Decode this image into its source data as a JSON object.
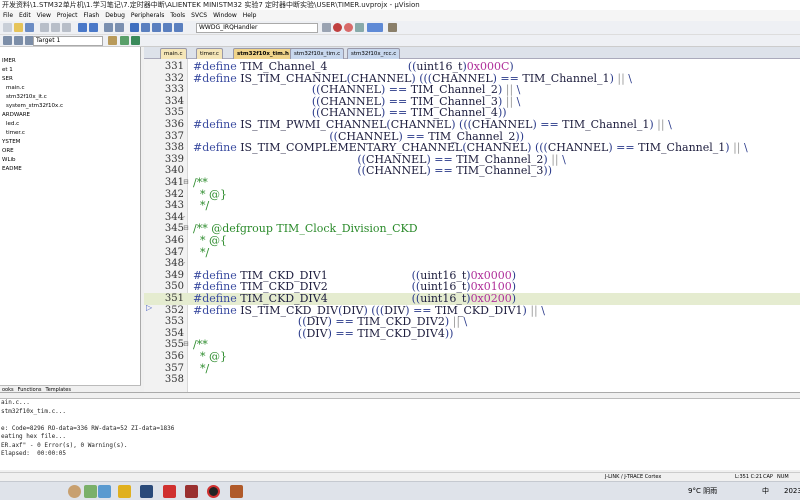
{
  "window": {
    "title": "开发资料\\1.STM32单片机\\1.学习笔记\\7.定时器中断\\ALIENTEK MINISTM32 实验7 定时器中断实验\\USER\\TIMER.uvprojx - µVision"
  },
  "menu": [
    "File",
    "Edit",
    "View",
    "Project",
    "Flash",
    "Debug",
    "Peripherals",
    "Tools",
    "SVCS",
    "Window",
    "Help"
  ],
  "toolbar": {
    "function_combo": "WWDG_IRQHandler",
    "target_combo": "Target 1"
  },
  "project_tree": [
    "IMER",
    "et 1",
    "SER",
    "main.c",
    "stm32f10x_it.c",
    "system_stm32f10x.c",
    "ARDWARE",
    "led.c",
    "timer.c",
    "YSTEM",
    "ORE",
    "WLib",
    "EADME"
  ],
  "panel_tabs": [
    "ooks",
    "Functions",
    "Templates"
  ],
  "tabs": [
    "main.c",
    "timer.c",
    "stm32f10x_tim.h",
    "stm32f10x_tim.c",
    "stm32f10x_rcc.c"
  ],
  "code_lines": [
    {
      "n": "331",
      "segs": [
        [
          "d",
          "#define "
        ],
        [
          "i",
          "TIM_Channel_4                       "
        ],
        [
          "o",
          "(("
        ],
        [
          "i",
          "uint16_t"
        ],
        [
          "o",
          ")"
        ],
        [
          "m",
          "0x000C"
        ],
        [
          "o",
          ")"
        ]
      ]
    },
    {
      "n": "332",
      "segs": [
        [
          "d",
          "#define "
        ],
        [
          "i",
          "IS_TIM_CHANNEL"
        ],
        [
          "o",
          "("
        ],
        [
          "i",
          "CHANNEL"
        ],
        [
          "o",
          ") ((("
        ],
        [
          "i",
          "CHANNEL"
        ],
        [
          "o",
          ") == "
        ],
        [
          "i",
          "TIM_Channel_1"
        ],
        [
          "o",
          ") "
        ],
        [
          "g",
          "||"
        ],
        [
          "o",
          " \\"
        ]
      ]
    },
    {
      "n": "333",
      "segs": [
        [
          "o",
          "                                  (("
        ],
        [
          "i",
          "CHANNEL"
        ],
        [
          "o",
          ") == "
        ],
        [
          "i",
          "TIM_Channel_2"
        ],
        [
          "o",
          ") "
        ],
        [
          "g",
          "||"
        ],
        [
          "o",
          " \\"
        ]
      ]
    },
    {
      "n": "334",
      "segs": [
        [
          "o",
          "                                  (("
        ],
        [
          "i",
          "CHANNEL"
        ],
        [
          "o",
          ") == "
        ],
        [
          "i",
          "TIM_Channel_3"
        ],
        [
          "o",
          ") "
        ],
        [
          "g",
          "||"
        ],
        [
          "o",
          " \\"
        ]
      ]
    },
    {
      "n": "335",
      "segs": [
        [
          "o",
          "                                  (("
        ],
        [
          "i",
          "CHANNEL"
        ],
        [
          "o",
          ") == "
        ],
        [
          "i",
          "TIM_Channel_4"
        ],
        [
          "o",
          "))"
        ]
      ]
    },
    {
      "n": "336",
      "segs": [
        [
          "d",
          "#define "
        ],
        [
          "i",
          "IS_TIM_PWMI_CHANNEL"
        ],
        [
          "o",
          "("
        ],
        [
          "i",
          "CHANNEL"
        ],
        [
          "o",
          ") ((("
        ],
        [
          "i",
          "CHANNEL"
        ],
        [
          "o",
          ") == "
        ],
        [
          "i",
          "TIM_Channel_1"
        ],
        [
          "o",
          ") "
        ],
        [
          "g",
          "||"
        ],
        [
          "o",
          " \\"
        ]
      ]
    },
    {
      "n": "337",
      "segs": [
        [
          "o",
          "                                       (("
        ],
        [
          "i",
          "CHANNEL"
        ],
        [
          "o",
          ") == "
        ],
        [
          "i",
          "TIM_Channel_2"
        ],
        [
          "o",
          "))"
        ]
      ]
    },
    {
      "n": "338",
      "segs": [
        [
          "d",
          "#define "
        ],
        [
          "i",
          "IS_TIM_COMPLEMENTARY_CHANNEL"
        ],
        [
          "o",
          "("
        ],
        [
          "i",
          "CHANNEL"
        ],
        [
          "o",
          ") ((("
        ],
        [
          "i",
          "CHANNEL"
        ],
        [
          "o",
          ") == "
        ],
        [
          "i",
          "TIM_Channel_1"
        ],
        [
          "o",
          ") "
        ],
        [
          "g",
          "||"
        ],
        [
          "o",
          " \\"
        ]
      ]
    },
    {
      "n": "339",
      "segs": [
        [
          "o",
          "                                               (("
        ],
        [
          "i",
          "CHANNEL"
        ],
        [
          "o",
          ") == "
        ],
        [
          "i",
          "TIM_Channel_2"
        ],
        [
          "o",
          ") "
        ],
        [
          "g",
          "||"
        ],
        [
          "o",
          " \\"
        ]
      ]
    },
    {
      "n": "340",
      "segs": [
        [
          "o",
          "                                               (("
        ],
        [
          "i",
          "CHANNEL"
        ],
        [
          "o",
          ") == "
        ],
        [
          "i",
          "TIM_Channel_3"
        ],
        [
          "o",
          "))"
        ]
      ]
    },
    {
      "n": "341",
      "f": "⊟",
      "segs": [
        [
          "c",
          "/**"
        ]
      ]
    },
    {
      "n": "342",
      "segs": [
        [
          "c",
          "  * @}"
        ]
      ]
    },
    {
      "n": "343",
      "segs": [
        [
          "c",
          "  */"
        ]
      ]
    },
    {
      "n": "344",
      "f": "-",
      "segs": []
    },
    {
      "n": "345",
      "f": "⊟",
      "segs": [
        [
          "c",
          "/** @defgroup TIM_Clock_Division_CKD"
        ]
      ]
    },
    {
      "n": "346",
      "segs": [
        [
          "c",
          "  * @{"
        ]
      ]
    },
    {
      "n": "347",
      "segs": [
        [
          "c",
          "  */"
        ]
      ]
    },
    {
      "n": "348",
      "f": "-",
      "segs": []
    },
    {
      "n": "349",
      "segs": [
        [
          "d",
          "#define "
        ],
        [
          "i",
          "TIM_CKD_DIV1                        "
        ],
        [
          "o",
          "(("
        ],
        [
          "i",
          "uint16_t"
        ],
        [
          "o",
          ")"
        ],
        [
          "m",
          "0x0000"
        ],
        [
          "o",
          ")"
        ]
      ]
    },
    {
      "n": "350",
      "segs": [
        [
          "d",
          "#define "
        ],
        [
          "i",
          "TIM_CKD_DIV2                        "
        ],
        [
          "o",
          "(("
        ],
        [
          "i",
          "uint16_t"
        ],
        [
          "o",
          ")"
        ],
        [
          "m",
          "0x0100"
        ],
        [
          "o",
          ")"
        ]
      ]
    },
    {
      "n": "351",
      "h": true,
      "segs": [
        [
          "d",
          "#define "
        ],
        [
          "i",
          "TIM_CKD_DIV4"
        ],
        [
          "o",
          "                        (("
        ],
        [
          "i",
          "uint16_t"
        ],
        [
          "o",
          ")"
        ],
        [
          "m",
          "0x0200"
        ],
        [
          "o",
          ")"
        ]
      ]
    },
    {
      "n": "352",
      "segs": [
        [
          "d",
          "#define "
        ],
        [
          "i",
          "IS_TIM_CKD_DIV"
        ],
        [
          "o",
          "("
        ],
        [
          "i",
          "DIV"
        ],
        [
          "o",
          ") ((("
        ],
        [
          "i",
          "DIV"
        ],
        [
          "o",
          ") == "
        ],
        [
          "i",
          "TIM_CKD_DIV1"
        ],
        [
          "o",
          ") "
        ],
        [
          "g",
          "||"
        ],
        [
          "o",
          " \\"
        ]
      ]
    },
    {
      "n": "353",
      "segs": [
        [
          "o",
          "                              (("
        ],
        [
          "i",
          "DIV"
        ],
        [
          "o",
          ") == "
        ],
        [
          "i",
          "TIM_CKD_DIV2"
        ],
        [
          "o",
          ") "
        ],
        [
          "g",
          "||"
        ],
        [
          "o",
          " \\"
        ]
      ]
    },
    {
      "n": "354",
      "segs": [
        [
          "o",
          "                              (("
        ],
        [
          "i",
          "DIV"
        ],
        [
          "o",
          ") == "
        ],
        [
          "i",
          "TIM_CKD_DIV4"
        ],
        [
          "o",
          "))"
        ]
      ]
    },
    {
      "n": "355",
      "f": "⊟",
      "segs": [
        [
          "c",
          "/**"
        ]
      ]
    },
    {
      "n": "356",
      "segs": [
        [
          "c",
          "  * @}"
        ]
      ]
    },
    {
      "n": "357",
      "segs": [
        [
          "c",
          "  */"
        ]
      ]
    },
    {
      "n": "358",
      "segs": []
    }
  ],
  "build_output": [
    "ain.c...",
    "stm32f10x_tim.c...",
    "",
    "e: Code=8296 RO-data=336 RW-data=52 ZI-data=1836",
    "eating hex file...",
    "ER.axf\" - 0 Error(s), 0 Warning(s).",
    "Elapsed:  00:00:05"
  ],
  "status": {
    "debugger": "J-LINK / J-TRACE Cortex",
    "position": "L:351 C:21",
    "caps": "CAP",
    "num": "NUM"
  },
  "taskbar": {
    "weather": "9°C 阴雨",
    "ime": "中",
    "year": "2023"
  }
}
